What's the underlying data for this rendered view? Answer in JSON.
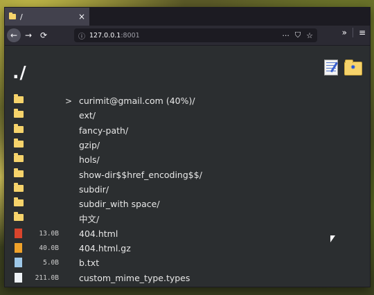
{
  "tab": {
    "title": "/",
    "close": "×"
  },
  "nav": {
    "back": "←",
    "forward": "→",
    "reload": "⟳",
    "url_host": "127.0.0.1",
    "url_port": ":8001",
    "page_actions": "···",
    "more": "»",
    "menu": "≡"
  },
  "page": {
    "title": "./"
  },
  "entries": [
    {
      "type": "folder",
      "size": "",
      "expand": ">",
      "name": "curimit@gmail.com (40%)/"
    },
    {
      "type": "folder",
      "size": "",
      "expand": "",
      "name": "ext/"
    },
    {
      "type": "folder",
      "size": "",
      "expand": "",
      "name": "fancy-path/"
    },
    {
      "type": "folder",
      "size": "",
      "expand": "",
      "name": "gzip/"
    },
    {
      "type": "folder",
      "size": "",
      "expand": "",
      "name": "hols/"
    },
    {
      "type": "folder",
      "size": "",
      "expand": "",
      "name": "show-dir$$href_encoding$$/"
    },
    {
      "type": "folder",
      "size": "",
      "expand": "",
      "name": "subdir/"
    },
    {
      "type": "folder",
      "size": "",
      "expand": "",
      "name": "subdir_with space/"
    },
    {
      "type": "folder",
      "size": "",
      "expand": "",
      "name": "中文/"
    },
    {
      "type": "file",
      "color": "red",
      "size": "13.0B",
      "expand": "",
      "name": "404.html"
    },
    {
      "type": "file",
      "color": "orange",
      "size": "40.0B",
      "expand": "",
      "name": "404.html.gz"
    },
    {
      "type": "file",
      "color": "blue",
      "size": "5.0B",
      "expand": "",
      "name": "b.txt"
    },
    {
      "type": "file",
      "color": "white",
      "size": "211.0B",
      "expand": "",
      "name": "custom_mime_type.types"
    }
  ]
}
